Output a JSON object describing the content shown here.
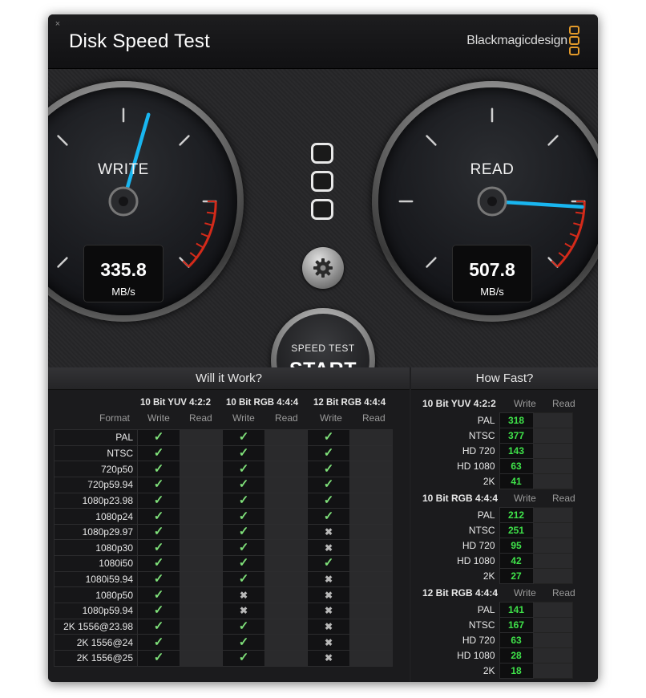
{
  "app": {
    "title": "Disk Speed Test",
    "brand": "Blackmagicdesign",
    "close": "×"
  },
  "write_gauge": {
    "label": "WRITE",
    "value": "335.8",
    "unit": "MB/s"
  },
  "read_gauge": {
    "label": "READ",
    "value": "507.8",
    "unit": "MB/s"
  },
  "start_button": {
    "line1": "SPEED TEST",
    "line2": "START"
  },
  "will_it_work": {
    "title": "Will it Work?",
    "format_label": "Format",
    "groups": [
      "10 Bit YUV 4:2:2",
      "10 Bit RGB 4:4:4",
      "12 Bit RGB 4:4:4"
    ],
    "write_label": "Write",
    "read_label": "Read",
    "check": "✓",
    "cross": "✖",
    "rows": [
      {
        "format": "PAL",
        "r": [
          1,
          1,
          1
        ]
      },
      {
        "format": "NTSC",
        "r": [
          1,
          1,
          1
        ]
      },
      {
        "format": "720p50",
        "r": [
          1,
          1,
          1
        ]
      },
      {
        "format": "720p59.94",
        "r": [
          1,
          1,
          1
        ]
      },
      {
        "format": "1080p23.98",
        "r": [
          1,
          1,
          1
        ]
      },
      {
        "format": "1080p24",
        "r": [
          1,
          1,
          1
        ]
      },
      {
        "format": "1080p29.97",
        "r": [
          1,
          1,
          0
        ]
      },
      {
        "format": "1080p30",
        "r": [
          1,
          1,
          0
        ]
      },
      {
        "format": "1080i50",
        "r": [
          1,
          1,
          1
        ]
      },
      {
        "format": "1080i59.94",
        "r": [
          1,
          1,
          0
        ]
      },
      {
        "format": "1080p50",
        "r": [
          1,
          0,
          0
        ]
      },
      {
        "format": "1080p59.94",
        "r": [
          1,
          0,
          0
        ]
      },
      {
        "format": "2K 1556@23.98",
        "r": [
          1,
          1,
          0
        ]
      },
      {
        "format": "2K 1556@24",
        "r": [
          1,
          1,
          0
        ]
      },
      {
        "format": "2K 1556@25",
        "r": [
          1,
          1,
          0
        ]
      }
    ]
  },
  "how_fast": {
    "title": "How Fast?",
    "write_label": "Write",
    "read_label": "Read",
    "groups": [
      {
        "name": "10 Bit YUV 4:2:2",
        "rows": [
          [
            "PAL",
            "318"
          ],
          [
            "NTSC",
            "377"
          ],
          [
            "HD 720",
            "143"
          ],
          [
            "HD 1080",
            "63"
          ],
          [
            "2K",
            "41"
          ]
        ]
      },
      {
        "name": "10 Bit RGB 4:4:4",
        "rows": [
          [
            "PAL",
            "212"
          ],
          [
            "NTSC",
            "251"
          ],
          [
            "HD 720",
            "95"
          ],
          [
            "HD 1080",
            "42"
          ],
          [
            "2K",
            "27"
          ]
        ]
      },
      {
        "name": "12 Bit RGB 4:4:4",
        "rows": [
          [
            "PAL",
            "141"
          ],
          [
            "NTSC",
            "167"
          ],
          [
            "HD 720",
            "63"
          ],
          [
            "HD 1080",
            "28"
          ],
          [
            "2K",
            "18"
          ]
        ]
      }
    ]
  },
  "colors": {
    "accent": "#e39a2a",
    "needle": "#19b6f0",
    "ok_green": "#3fe24a",
    "redline": "#d42a1a"
  }
}
